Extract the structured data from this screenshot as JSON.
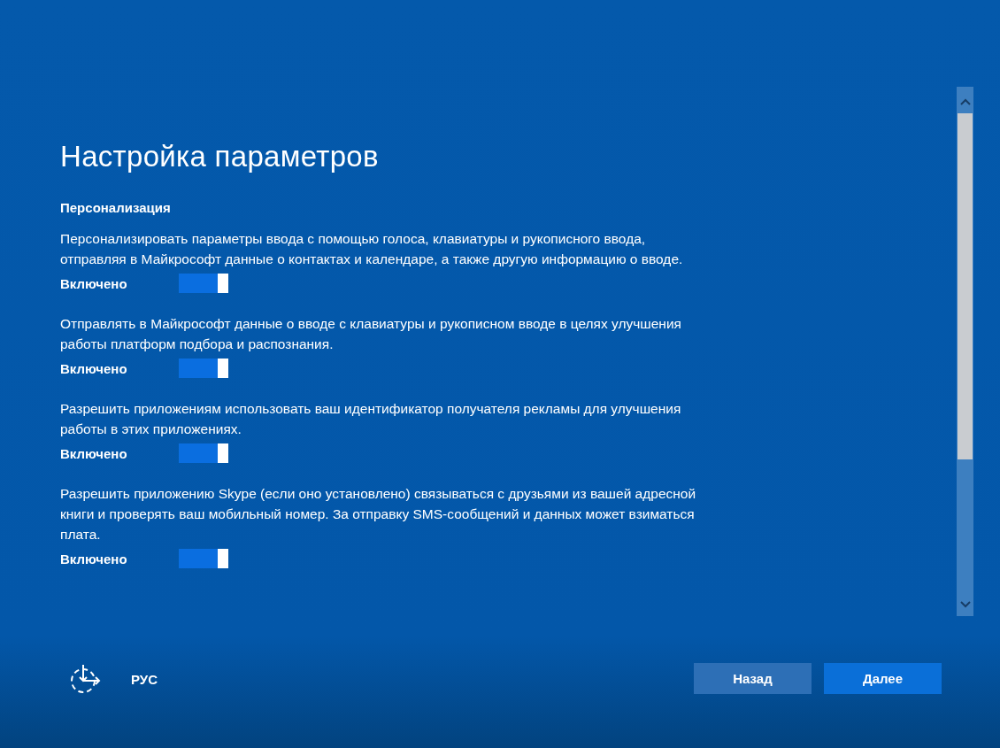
{
  "title": "Настройка параметров",
  "section": {
    "heading": "Персонализация",
    "settings": [
      {
        "description": "Персонализировать параметры ввода с помощью голоса, клавиатуры и рукописного ввода, отправляя в Майкрософт данные о контактах и календаре, а также другую информацию о вводе.",
        "state_label": "Включено",
        "on": true
      },
      {
        "description": "Отправлять в Майкрософт данные о вводе с клавиатуры и рукописном вводе в целях улучшения работы платформ подбора и распознания.",
        "state_label": "Включено",
        "on": true
      },
      {
        "description": "Разрешить приложениям использовать ваш идентификатор получателя рекламы для улучшения работы в этих приложениях.",
        "state_label": "Включено",
        "on": true
      },
      {
        "description": "Разрешить приложению Skype (если оно установлено) связываться с друзьями из вашей адресной книги и проверять ваш мобильный номер. За отправку SMS-сообщений и данных может взиматься плата.",
        "state_label": "Включено",
        "on": true
      }
    ]
  },
  "footer": {
    "language": "РУС",
    "buttons": [
      {
        "label": "Назад",
        "kind": "secondary"
      },
      {
        "label": "Далее",
        "kind": "primary"
      }
    ]
  }
}
